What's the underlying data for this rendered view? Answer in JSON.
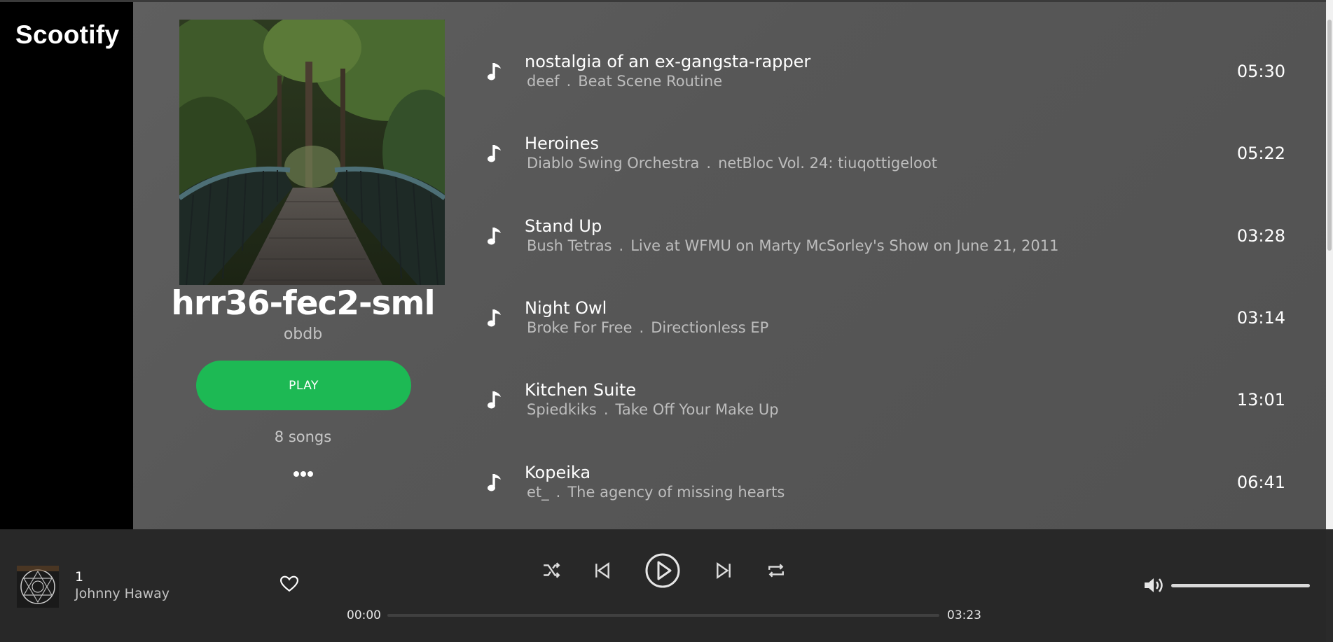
{
  "app": {
    "name": "Scootify"
  },
  "playlist": {
    "title": "hrr36-fec2-sml",
    "owner": "obdb",
    "play_label": "PLAY",
    "song_count": "8 songs",
    "more_icon": "more-dots-icon"
  },
  "tracks": [
    {
      "title": "nostalgia of an ex-gangsta-rapper",
      "artist": "deef",
      "separator": ".",
      "album": "Beat Scene Routine",
      "duration": "05:30"
    },
    {
      "title": "Heroines",
      "artist": "Diablo Swing Orchestra",
      "separator": ".",
      "album": "netBloc Vol. 24: tiuqottigeloot",
      "duration": "05:22"
    },
    {
      "title": "Stand Up",
      "artist": "Bush Tetras",
      "separator": ".",
      "album": "Live at WFMU on Marty McSorley's Show on June 21, 2011",
      "duration": "03:28"
    },
    {
      "title": "Night Owl",
      "artist": "Broke For Free",
      "separator": ".",
      "album": "Directionless EP",
      "duration": "03:14"
    },
    {
      "title": "Kitchen Suite",
      "artist": "Spiedkiks",
      "separator": ".",
      "album": "Take Off Your Make Up",
      "duration": "13:01"
    },
    {
      "title": "Kopeika",
      "artist": "et_",
      "separator": ".",
      "album": "The agency of missing hearts",
      "duration": "06:41"
    }
  ],
  "now_playing": {
    "title": "1",
    "artist": "Johnny Haway",
    "elapsed": "00:00",
    "total": "03:23",
    "progress_fraction": 0.0,
    "volume_fraction": 1.0
  },
  "icons": {
    "shuffle": "shuffle-icon",
    "previous": "skip-previous-icon",
    "play": "play-circle-icon",
    "next": "skip-next-icon",
    "repeat": "repeat-icon",
    "like": "heart-icon",
    "volume": "volume-icon",
    "track": "music-note-icon"
  },
  "colors": {
    "accent": "#1db954",
    "sidebar": "#000000",
    "player_bar": "#282828"
  }
}
